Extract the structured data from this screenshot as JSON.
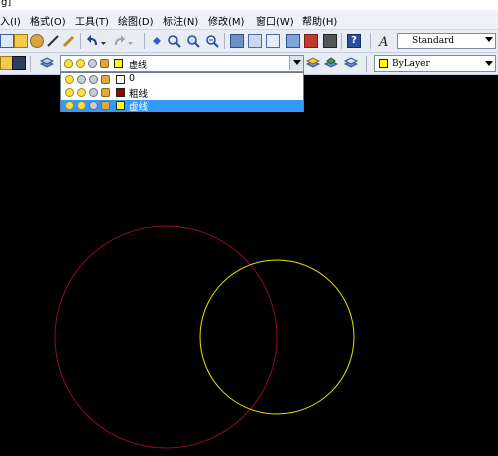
{
  "title": "g]",
  "menus": [
    "入(I)",
    "格式(O)",
    "工具(T)",
    "绘图(D)",
    "标注(N)",
    "修改(M)",
    "窗口(W)",
    "帮助(H)"
  ],
  "text_style": {
    "value": "Standard"
  },
  "layer_combo": {
    "value": "虚线"
  },
  "color_combo": {
    "value": "ByLayer",
    "swatch": "#ffff00"
  },
  "layers": [
    {
      "name": "0",
      "swatch": "#ffffff",
      "selected": false
    },
    {
      "name": "粗线",
      "swatch": "#990000",
      "selected": false
    },
    {
      "name": "虚线",
      "swatch": "#ffff00",
      "selected": true
    }
  ],
  "drawing": {
    "circles": [
      {
        "name": "circle-red",
        "color": "#8e0f1f"
      },
      {
        "name": "circle-yellow",
        "color": "#e6e600"
      }
    ]
  },
  "colors": {
    "background": "#000000",
    "selection": "#3399ff"
  }
}
